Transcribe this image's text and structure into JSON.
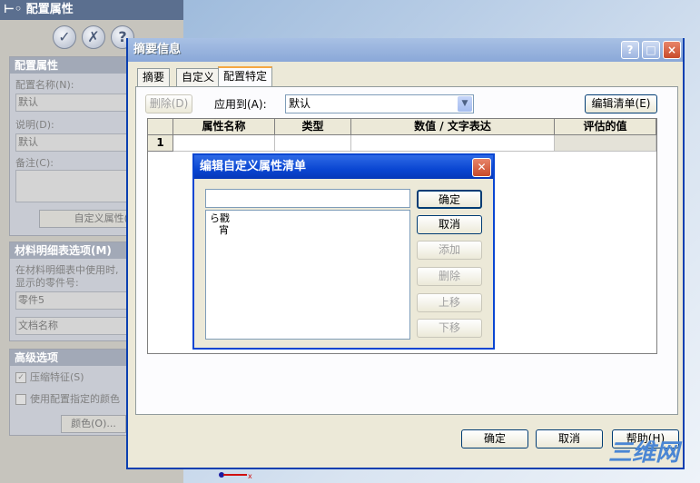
{
  "left_panel": {
    "title": "配置属性",
    "action_icons": [
      "check-icon",
      "cancel-icon",
      "help-icon"
    ],
    "config_section": {
      "header": "配置属性",
      "name_label": "配置名称(N):",
      "name_value": "默认",
      "desc_label": "说明(D):",
      "desc_value": "默认",
      "note_label": "备注(C):",
      "custom_props_button": "自定义属性(T)..."
    },
    "bom_section": {
      "header": "材料明细表选项(M)",
      "desc_line1": "在材料明细表中使用时,",
      "desc_line2": "显示的零件号:",
      "part_value": "零件5",
      "doc_name": "文档名称"
    },
    "advanced_section": {
      "header": "高级选项",
      "suppress_label": "压缩特征(S)",
      "use_color_label": "使用配置指定的颜色",
      "color_button": "颜色(O)..."
    }
  },
  "summary_dialog": {
    "title": "摘要信息",
    "window_controls": [
      "?",
      "□",
      "×"
    ],
    "tabs": [
      {
        "label": "摘要",
        "active": false
      },
      {
        "label": "自定义",
        "active": false
      },
      {
        "label": "配置特定",
        "active": true
      }
    ],
    "delete_button": "删除(D)",
    "apply_to_label": "应用到(A):",
    "apply_to_value": "默认",
    "edit_list_button": "编辑清单(E)",
    "grid": {
      "columns": [
        "属性名称",
        "类型",
        "数值 / 文字表达",
        "评估的值"
      ],
      "row_numbers": [
        "1"
      ]
    },
    "ok_button": "确定",
    "cancel_button": "取消",
    "help_button": "帮助(H)"
  },
  "edit_dialog": {
    "title": "编辑自定义属性清单",
    "input_value": "",
    "list_items": [
      "ら戳",
      "宵"
    ],
    "buttons": {
      "ok": "确定",
      "cancel": "取消",
      "add": "添加",
      "delete": "删除",
      "move_up": "上移",
      "move_down": "下移"
    }
  },
  "watermark": "三维网",
  "colors": {
    "active_title": "#0a46d2",
    "inactive_title": "#8aa8d8",
    "tab_highlight": "#f5a742",
    "dialog_bg": "#ece9d8"
  }
}
